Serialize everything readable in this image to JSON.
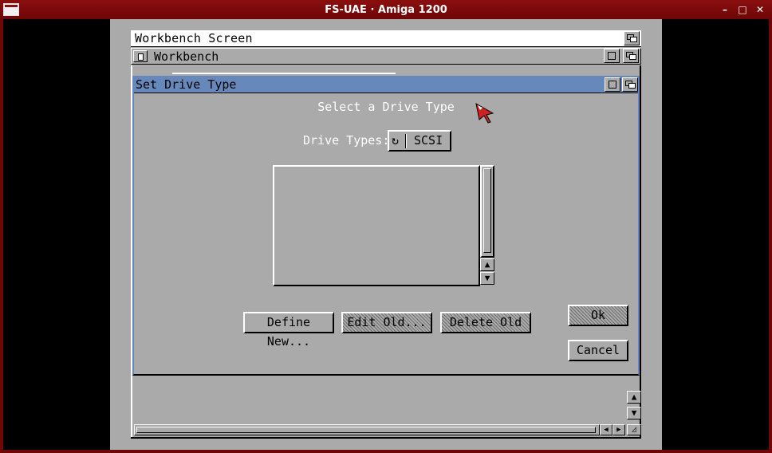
{
  "host_window": {
    "title": "FS-UAE · Amiga 1200",
    "controls": {
      "minimize": "–",
      "maximize": "□",
      "close": "✕"
    }
  },
  "workbench": {
    "screen_title": "Workbench Screen",
    "window_title": "Workbench"
  },
  "dialog": {
    "title": "Set Drive Type",
    "heading": "Select a Drive Type",
    "drive_types_label": "Drive Types:",
    "drive_types_value": "SCSI",
    "buttons": {
      "define_new": "Define New...",
      "edit_old": "Edit Old...",
      "delete_old": "Delete Old",
      "ok": "Ok",
      "cancel": "Cancel"
    },
    "list_items": []
  },
  "icons": {
    "cycle": "cycle-gadget-icon",
    "up": "▲",
    "down": "▼",
    "left": "◀",
    "right": "▶"
  },
  "colors": {
    "host_title": "#8a0f0f",
    "amiga_gray": "#aaaaaa",
    "dialog_title": "#6688bb"
  }
}
